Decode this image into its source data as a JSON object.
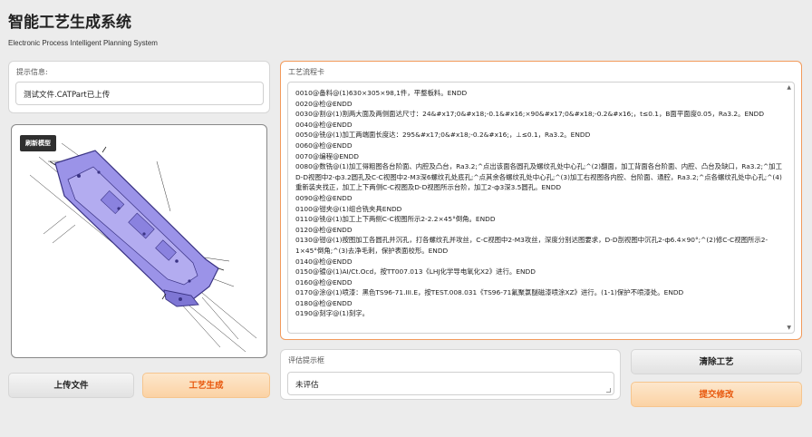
{
  "app": {
    "title": "智能工艺生成系统",
    "subtitle": "Electronic Process Intelligent Planning System"
  },
  "hint": {
    "label": "提示信息:",
    "value": "测试文件.CATPart已上传"
  },
  "model": {
    "refresh_label": "刷新模型"
  },
  "buttons": {
    "upload": "上传文件",
    "generate": "工艺生成",
    "clear": "清除工艺",
    "submit": "提交修改"
  },
  "process_card": {
    "label": "工艺流程卡",
    "lines": [
      "0010@备料@(1)630×305×98,1件，平整板料。ENDD",
      "0020@检@ENDD",
      "0030@割@(1)割两大面及两侧面达尺寸：24&#x17;0&#x18;-0.1&#x16;×90&#x17;0&#x18;-0.2&#x16;，t≤0.1，B面平面度0.05，Ra3.2。ENDD",
      "0040@检@ENDD",
      "0050@铣@(1)加工两端面长度达：295&#x17;0&#x18;-0.2&#x16;，⊥≤0.1，Ra3.2。ENDD",
      "0060@检@ENDD",
      "0070@编程@ENDD",
      "0080@数铣@(1)加工得粗图各台阶面、内腔及凸台，Ra3.2;^点出该面各圆孔及螺纹孔处中心孔;^(2)翻面，加工背面各台阶面、内腔、凸台及缺口，Ra3.2;^加工D-D视图中2-ф3.2圆孔及C-C视图中2-M3深6螺纹孔处底孔;^点其余各螺纹孔处中心孔;^(3)加工右视图各内腔、台阶面、通腔，Ra3.2;^点各螺纹孔处中心孔;^(4)重新装夹找正，加工上下两侧C-C视图及D-D视图所示台阶，加工2-ф3深3.5圆孔。ENDD",
      "0090@检@ENDD",
      "0100@钳夹@(1)组合铣夹具ENDD",
      "0110@铣@(1)加工上下两侧C-C视图所示2-2.2×45°倒角。ENDD",
      "0120@检@ENDD",
      "0130@钳@(1)按图加工各圆孔并沉孔，打各螺纹孔并攻丝，C-C视图中2-M3攻丝，深度分别达图要求，D-D剖视图中沉孔2-ф6.4×90°;^(2)修C-C视图所示2-1×45°倒角;^(3)去净毛刺，保护表面校形。ENDD",
      "0140@检@ENDD",
      "0150@镀@(1)AI/Ct.Ocd，按TT007.013《LHJ化学导电氧化X2》进行。ENDD",
      "0160@检@ENDD",
      "0170@涂@(1)喷漆：黑色TS96-71.III.E，按TEST.008.031《TS96-71氟聚氯醚磁漆喷涂XZ》进行。(1-1)保护不喷漆处。ENDD",
      "0180@检@ENDD",
      "0190@刻字@(1)刻字。"
    ]
  },
  "evaluation": {
    "label": "评估提示框",
    "value": "未评估"
  },
  "colors": {
    "accent_orange": "#e8570c",
    "card_border": "#f29a5b",
    "model_part": "#9b93e8"
  }
}
